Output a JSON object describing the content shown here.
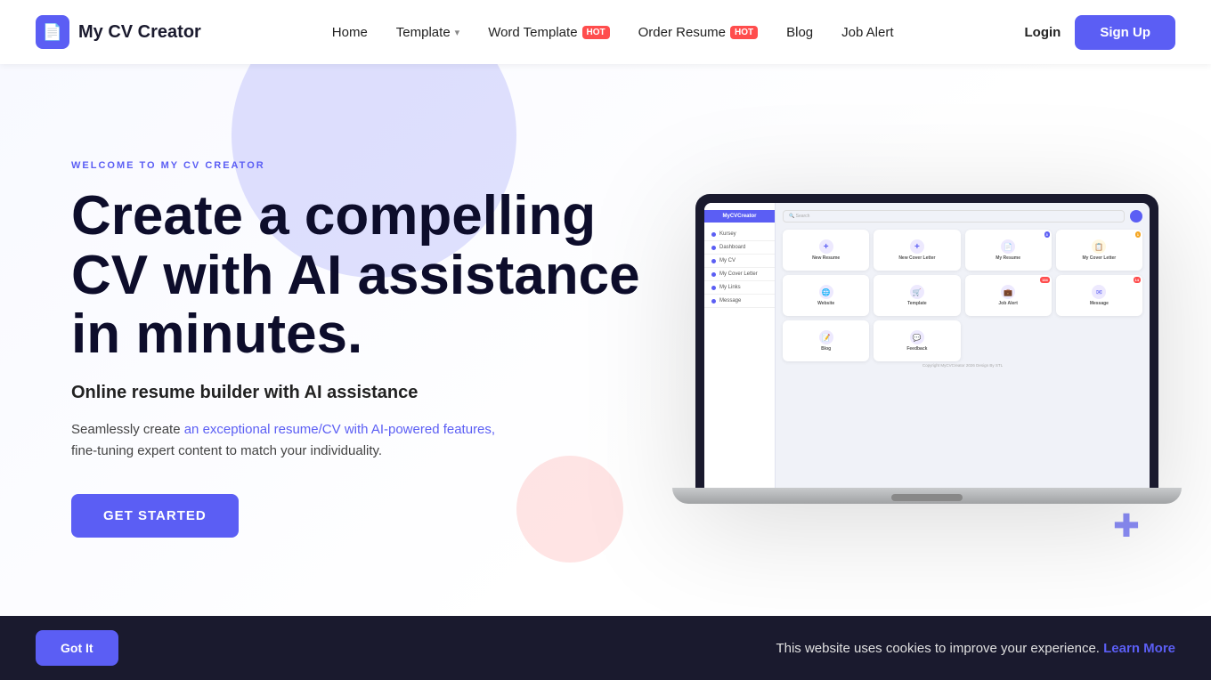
{
  "logo": {
    "icon": "📄",
    "text": "My CV Creator"
  },
  "nav": {
    "links": [
      {
        "id": "home",
        "label": "Home",
        "hot": false,
        "dropdown": false
      },
      {
        "id": "template",
        "label": "Template",
        "hot": false,
        "dropdown": true
      },
      {
        "id": "word-template",
        "label": "Word Template",
        "hot": true,
        "dropdown": false
      },
      {
        "id": "order-resume",
        "label": "Order Resume",
        "hot": true,
        "dropdown": false
      },
      {
        "id": "blog",
        "label": "Blog",
        "hot": false,
        "dropdown": false
      },
      {
        "id": "job-alert",
        "label": "Job Alert",
        "hot": false,
        "dropdown": false
      }
    ],
    "login_label": "Login",
    "signup_label": "Sign Up"
  },
  "hero": {
    "welcome_label": "WELCOME TO MY CV CREATOR",
    "title": "Create a compelling CV with AI assistance in minutes.",
    "subtitle": "Online resume builder with AI assistance",
    "desc_plain": "Seamlessly create ",
    "desc_link": "an exceptional resume/CV with AI-powered features,",
    "desc_end": "\nfine-tuning expert content to match your individuality.",
    "cta_label": "GET STARTED"
  },
  "laptop": {
    "sidebar_header": "MyCVCreator",
    "sidebar_items": [
      "Kursey",
      "Dashboard",
      "My CV",
      "My Cover Letter",
      "My Links",
      "Message"
    ],
    "search_placeholder": "Search",
    "cards": [
      {
        "label": "New Resume",
        "icon": "+",
        "color": "#5b5ef4",
        "badge": null
      },
      {
        "label": "New Cover Letter",
        "icon": "+",
        "color": "#5b5ef4",
        "badge": null
      },
      {
        "label": "My Resume",
        "icon": "📄",
        "color": "#5b5ef4",
        "badge": "3",
        "badge_color": "blue"
      },
      {
        "label": "My Cover Letter",
        "icon": "✉",
        "color": "#f5a623",
        "badge": "1",
        "badge_color": "yellow"
      },
      {
        "label": "Website",
        "icon": "🌐",
        "color": "#5b5ef4",
        "badge": null
      },
      {
        "label": "Template",
        "icon": "🛒",
        "color": "#5b5ef4",
        "badge": null
      },
      {
        "label": "Job Alert",
        "icon": "💼",
        "color": "#5b5ef4",
        "badge": "134",
        "badge_color": "red"
      },
      {
        "label": "Message",
        "icon": "✉",
        "color": "#5b5ef4",
        "badge": "14",
        "badge_color": "red"
      },
      {
        "label": "Blog",
        "icon": "📝",
        "color": "#5b5ef4",
        "badge": null
      },
      {
        "label": "Feedback",
        "icon": "💬",
        "color": "#5b5ef4",
        "badge": null
      }
    ],
    "copyright": "Copyright MyCVCreator 2026 Design By STL"
  },
  "cookie": {
    "text": "This website uses cookies to improve your experience.",
    "link_text": "Learn More",
    "got_it_label": "Got It"
  }
}
